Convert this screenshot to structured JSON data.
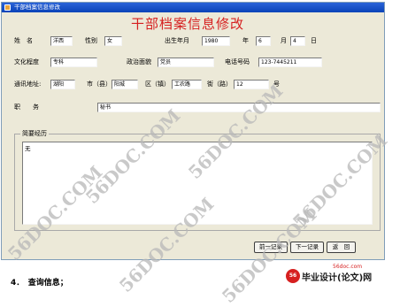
{
  "window": {
    "title": "干部档案信息修改"
  },
  "form": {
    "heading": "干部档案信息修改",
    "name": {
      "label": "姓　名",
      "value": "洋西"
    },
    "gender": {
      "label": "性别",
      "value": "女"
    },
    "birth": {
      "label": "出生年月",
      "year": "1980",
      "year_unit": "年",
      "month": "6",
      "month_unit": "月",
      "day": "4",
      "day_unit": "日"
    },
    "education": {
      "label": "文化程度",
      "value": "专科"
    },
    "political": {
      "label": "政治面貌",
      "value": "党员"
    },
    "phone": {
      "label": "电话号码",
      "value": "123-7445211"
    },
    "address": {
      "label": "通讯地址:",
      "province": "湖阳",
      "city_label": "市（县）",
      "city": "阳城",
      "district_label": "区（镇）",
      "district": "工农路",
      "street_label": "街（路）",
      "street": "12",
      "number_label": "号"
    },
    "position": {
      "label": "职　　务",
      "value": "秘书"
    },
    "resume": {
      "label": "简要经历",
      "value": "无"
    }
  },
  "buttons": {
    "prev": "前一记录",
    "next": "下一记录",
    "back": "返　回"
  },
  "document": {
    "step": "4．　查询信息；"
  },
  "watermarks": [
    "56DOC.COM",
    "56DOC.COM",
    "56DOC.COM",
    "56DOC.COM",
    "56DOC.COM",
    "56DOC.COM"
  ],
  "brand": {
    "url": "56doc.com",
    "name": "毕业设计(论文)网",
    "logo_text": "56"
  }
}
